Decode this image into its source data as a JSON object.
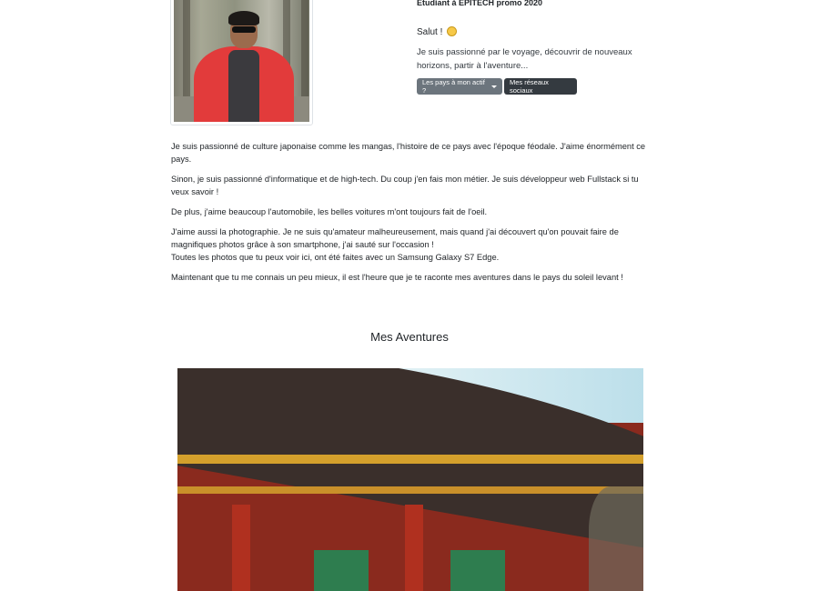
{
  "header": {
    "tagline": "Etudiant à EPITECH promo 2020",
    "greeting": "Salut !",
    "intro": "Je suis passionné par le voyage, découvrir de nouveaux horizons, partir à l'aventure..."
  },
  "buttons": {
    "countries_label": "Les pays à mon actif ?",
    "social_label": "Mes réseaux sociaux"
  },
  "icons": {
    "greeting_emoji": "smiling-face-icon",
    "dropdown": "caret-down-icon"
  },
  "bio": {
    "paragraphs": [
      "Je suis passionné de culture japonaise comme les mangas, l'histoire de ce pays avec l'époque féodale. J'aime énormément ce pays.",
      "Sinon, je suis passionné d'informatique et de high-tech. Du coup j'en fais mon métier. Je suis développeur web Fullstack si tu veux savoir !",
      "De plus, j'aime beaucoup l'automobile, les belles voitures m'ont toujours fait de l'oeil.",
      "J'aime aussi la photographie. Je ne suis qu'amateur malheureusement, mais quand j'ai découvert qu'on pouvait faire de magnifiques photos grâce à son smartphone, j'ai sauté sur l'occasion !",
      "Toutes les photos que tu peux voir ici, ont été faites avec un Samsung Galaxy S7 Edge.",
      "Maintenant que tu me connais un peu mieux, il est l'heure que je te raconte mes aventures dans le pays du soleil levant !"
    ]
  },
  "adventures": {
    "title": "Mes Aventures"
  }
}
